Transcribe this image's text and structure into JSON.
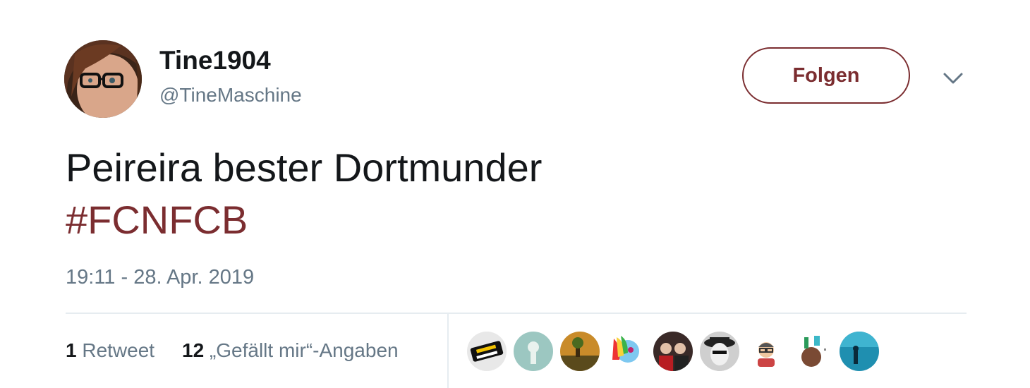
{
  "author": {
    "display_name": "Tine1904",
    "handle": "@TineMaschine",
    "avatar_icon": "profile-photo"
  },
  "follow_button": {
    "label": "Folgen",
    "color": "#7b2d30"
  },
  "menu_icon": "chevron-down-icon",
  "tweet": {
    "text": "Peireira bester Dortmunder",
    "hashtag": "#FCNFCB",
    "timestamp": "19:11 - 28. Apr. 2019"
  },
  "stats": {
    "retweet_count": "1",
    "retweet_label": "Retweet",
    "like_count": "12",
    "like_label": "„Gefällt mir“-Angaben"
  },
  "likers": [
    {
      "icon": "liker-avatar-1"
    },
    {
      "icon": "liker-avatar-2"
    },
    {
      "icon": "liker-avatar-3"
    },
    {
      "icon": "liker-avatar-4"
    },
    {
      "icon": "liker-avatar-5"
    },
    {
      "icon": "liker-avatar-6"
    },
    {
      "icon": "liker-avatar-7"
    },
    {
      "icon": "liker-avatar-8"
    },
    {
      "icon": "liker-avatar-9"
    }
  ],
  "colors": {
    "accent": "#7b2d30",
    "text": "#14171a",
    "secondary": "#657786",
    "divider": "#e6ecf0"
  }
}
